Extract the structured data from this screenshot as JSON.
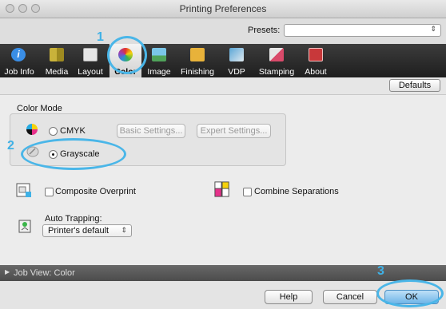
{
  "window": {
    "title": "Printing Preferences"
  },
  "presets": {
    "label": "Presets:",
    "value": ""
  },
  "toolbar": {
    "items": [
      {
        "label": "Job Info",
        "icon": "info-icon",
        "color": "#3a8ee6"
      },
      {
        "label": "Media",
        "icon": "media-icon",
        "color": "#c9b23a"
      },
      {
        "label": "Layout",
        "icon": "layout-icon",
        "color": "#d8d8d8"
      },
      {
        "label": "Color",
        "icon": "color-wheel-icon",
        "color": "#e0443a"
      },
      {
        "label": "Image",
        "icon": "image-icon",
        "color": "#4fa35a"
      },
      {
        "label": "Finishing",
        "icon": "finishing-icon",
        "color": "#e8b23a"
      },
      {
        "label": "VDP",
        "icon": "vdp-icon",
        "color": "#5aa6d6"
      },
      {
        "label": "Stamping",
        "icon": "stamping-icon",
        "color": "#d94a6a"
      },
      {
        "label": "About",
        "icon": "about-icon",
        "color": "#c8383a"
      }
    ],
    "selected": "Color"
  },
  "defaults_label": "Defaults",
  "color_mode": {
    "title": "Color Mode",
    "cmyk_label": "CMYK",
    "grayscale_label": "Grayscale",
    "selected": "Grayscale",
    "basic_settings_label": "Basic Settings...",
    "expert_settings_label": "Expert Settings..."
  },
  "composite_overprint_label": "Composite Overprint",
  "combine_separations_label": "Combine Separations",
  "auto_trapping": {
    "label": "Auto Trapping:",
    "value": "Printer's default"
  },
  "job_view_label": "Job View: Color",
  "footer": {
    "help_label": "Help",
    "cancel_label": "Cancel",
    "ok_label": "OK"
  },
  "callouts": [
    "1",
    "2",
    "3"
  ],
  "accent_color": "#4ab6e8"
}
